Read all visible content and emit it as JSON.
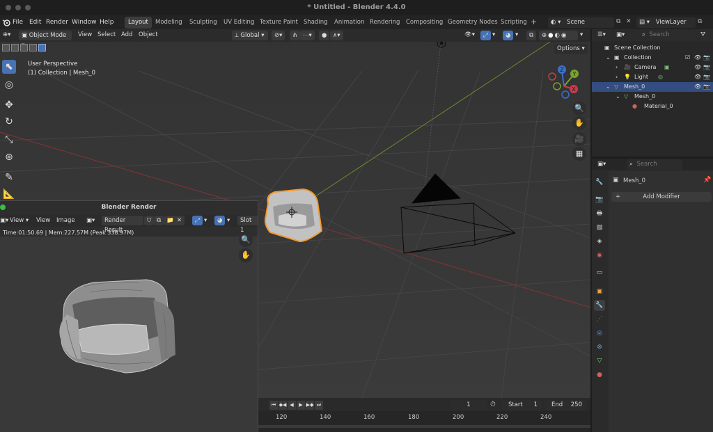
{
  "window": {
    "title": "* Untitled - Blender 4.4.0"
  },
  "menu": [
    "File",
    "Edit",
    "Render",
    "Window",
    "Help"
  ],
  "workspaces": [
    "Layout",
    "Modeling",
    "Sculpting",
    "UV Editing",
    "Texture Paint",
    "Shading",
    "Animation",
    "Rendering",
    "Compositing",
    "Geometry Nodes",
    "Scripting"
  ],
  "active_workspace": "Layout",
  "scene": {
    "name": "Scene",
    "view_layer": "ViewLayer"
  },
  "viewport": {
    "mode": "Object Mode",
    "menus": [
      "View",
      "Select",
      "Add",
      "Object"
    ],
    "transform": "Global",
    "options_label": "Options",
    "perspective": "User Perspective",
    "collection_info": "(1) Collection | Mesh_0",
    "gizmo_axes": {
      "x": "X",
      "y": "Y",
      "z": "Z"
    }
  },
  "render_window": {
    "title": "Blender Render",
    "menus": [
      "View",
      "View",
      "Image"
    ],
    "image": "Render Result",
    "slot": "Slot 1",
    "stats": "Time:01:50.69 | Mem:227.57M (Peak 338.97M)"
  },
  "timeline": {
    "current_frame": "1",
    "start_label": "Start",
    "start": "1",
    "end_label": "End",
    "end": "250",
    "ruler": [
      "120",
      "140",
      "160",
      "180",
      "200",
      "220",
      "240"
    ]
  },
  "outliner": {
    "search_placeholder": "Search",
    "root": "Scene Collection",
    "collection": "Collection",
    "items": [
      "Camera",
      "Light",
      "Mesh_0",
      "Mesh_0",
      "Material_0"
    ]
  },
  "properties": {
    "search_placeholder": "Search",
    "object": "Mesh_0",
    "add_modifier": "Add Modifier"
  },
  "colors": {
    "accent": "#4772b3",
    "selection": "#ffa033",
    "x_axis": "#8a3232",
    "y_axis": "#6b8a32"
  }
}
